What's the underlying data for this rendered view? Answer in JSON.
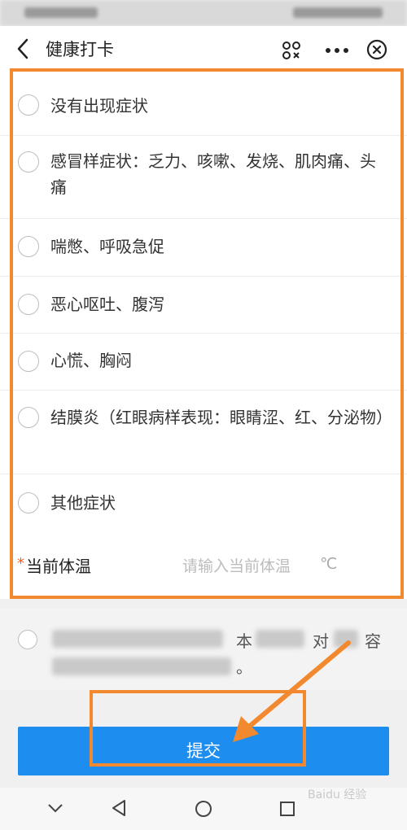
{
  "nav": {
    "title": "健康打卡",
    "icons": [
      "back-icon",
      "scan-icon",
      "more-icon",
      "close-circle-icon"
    ]
  },
  "symptoms": [
    {
      "label": "没有出现症状"
    },
    {
      "label": "感冒样症状：乏力、咳嗽、发烧、肌肉痛、头痛"
    },
    {
      "label": "喘憋、呼吸急促"
    },
    {
      "label": "恶心呕吐、腹泻"
    },
    {
      "label": "心慌、胸闷"
    },
    {
      "label": "结膜炎（红眼病样表现：眼睛涩、红、分泌物）"
    },
    {
      "label": "其他症状"
    }
  ],
  "temperature": {
    "required_mark": "*",
    "label": "当前体温",
    "placeholder": "请输入当前体温",
    "unit": "℃"
  },
  "agreement": {
    "visible_fragment_1": "本",
    "visible_fragment_2": "对",
    "visible_fragment_3": "容",
    "visible_fragment_4": "。"
  },
  "submit": {
    "label": "提交"
  },
  "colors": {
    "primary": "#1d8df0",
    "annotation": "#f2892e",
    "required": "#ff5a1f"
  },
  "watermark": "Baidu 经验"
}
